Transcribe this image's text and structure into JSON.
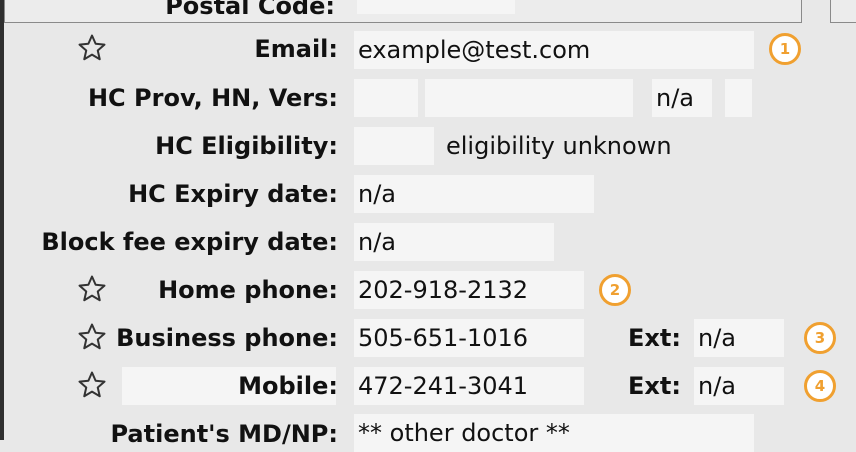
{
  "top_section": {
    "postal_code_label": "Postal Code:"
  },
  "rows": {
    "email": {
      "label": "Email:",
      "value": "example@test.com",
      "badge": "1"
    },
    "hc": {
      "label": "HC Prov, HN, Vers:",
      "prov": "",
      "hn": "",
      "version": "n/a",
      "extra": ""
    },
    "hc_eligibility": {
      "label": "HC Eligibility:",
      "value": "",
      "status": "eligibility unknown"
    },
    "hc_expiry": {
      "label": "HC Expiry date:",
      "value": "n/a"
    },
    "block_fee": {
      "label": "Block fee expiry date:",
      "value": "n/a"
    },
    "home_phone": {
      "label": "Home phone:",
      "value": "202-918-2132",
      "badge": "2"
    },
    "business_phone": {
      "label": "Business phone:",
      "value": "505-651-1016",
      "ext_label": "Ext:",
      "ext_value": "n/a",
      "badge": "3"
    },
    "mobile": {
      "label": "Mobile:",
      "value": "472-241-3041",
      "ext_label": "Ext:",
      "ext_value": "n/a",
      "badge": "4"
    },
    "patient_md": {
      "label": "Patient's MD/NP:",
      "value": "** other doctor **"
    }
  },
  "icons": {
    "star": "star-outline-icon"
  },
  "colors": {
    "badge": "#f0a030",
    "field": "#f5f5f5",
    "background": "#e8e8e8"
  }
}
